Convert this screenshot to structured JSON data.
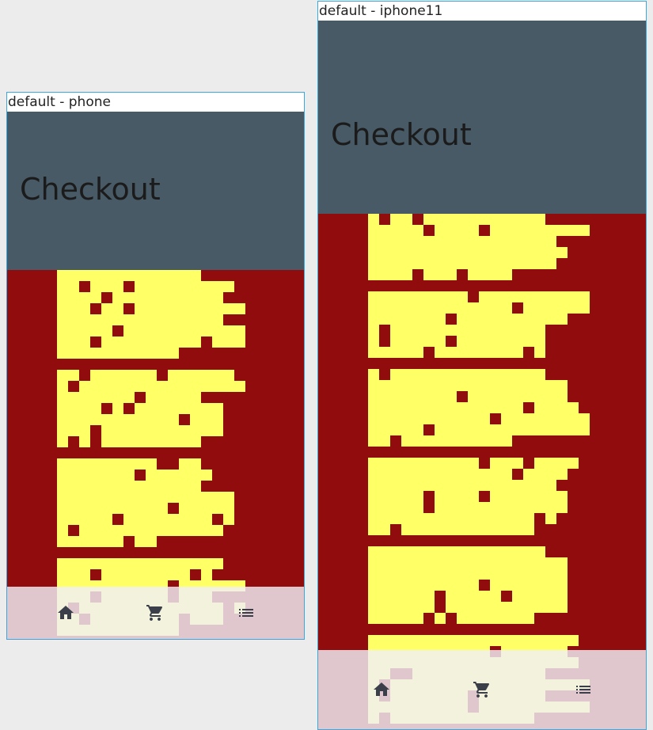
{
  "colors": {
    "frame_border": "#3aa7e0",
    "app_bar": "#475a66",
    "title_text": "#1b1b1b",
    "content_bg": "#910d0d",
    "pattern": "#ffff66",
    "bottom_nav": "#f0f0f8",
    "nav_icon": "#3a3f4a"
  },
  "frames": {
    "phone": {
      "label": "default - phone",
      "app_bar_title": "Checkout",
      "nav": [
        {
          "icon": "home-icon"
        },
        {
          "icon": "cart-icon"
        },
        {
          "icon": "list-icon"
        }
      ]
    },
    "iphone11": {
      "label": "default - iphone11",
      "app_bar_title": "Checkout",
      "nav": [
        {
          "icon": "home-icon"
        },
        {
          "icon": "cart-icon"
        },
        {
          "icon": "list-icon"
        }
      ]
    }
  }
}
